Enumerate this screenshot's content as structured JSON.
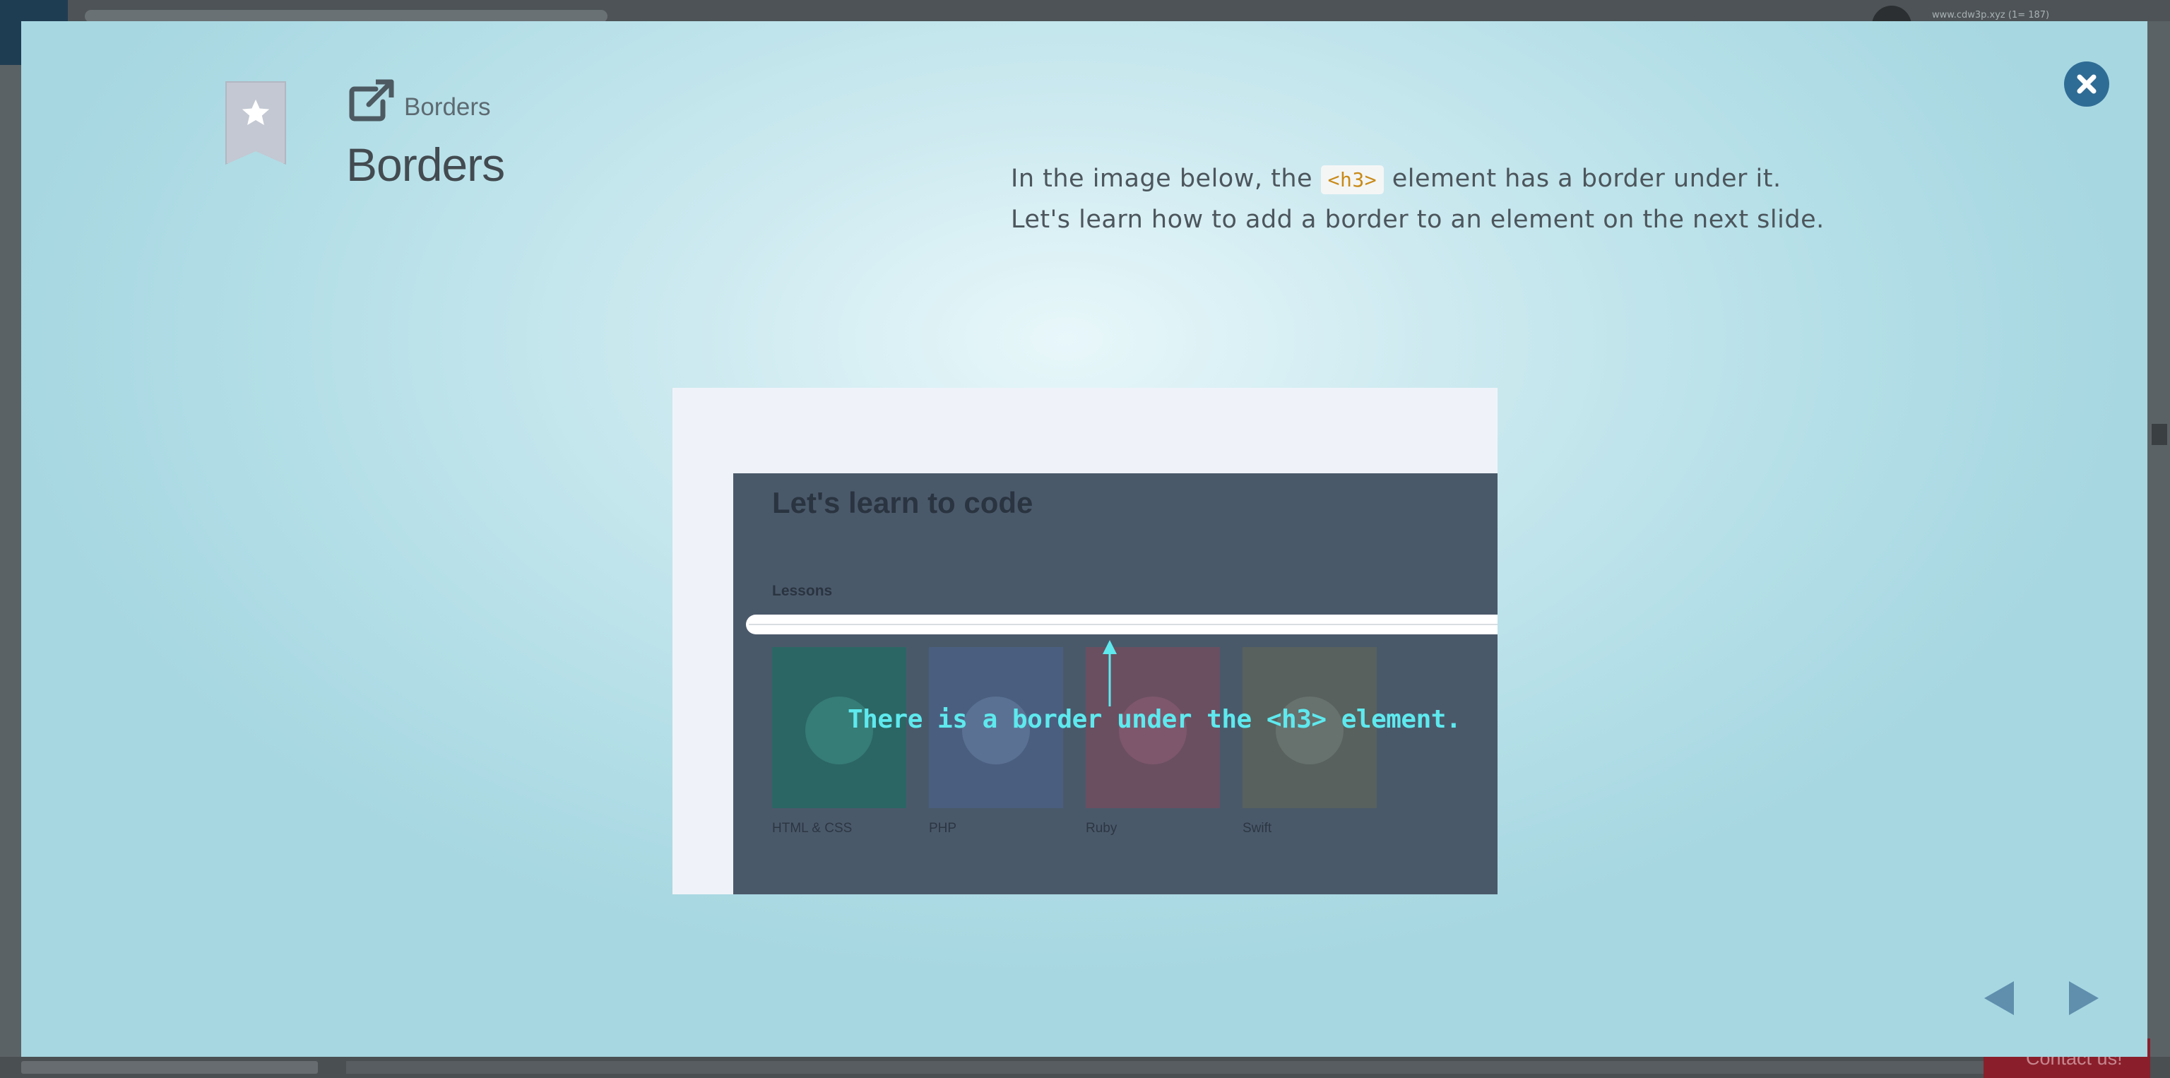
{
  "background": {
    "site_text": "www.cdw3p.xyz (1= 187)",
    "contact_label": "Contact us!"
  },
  "modal": {
    "breadcrumb": "Borders",
    "title": "Borders",
    "description": {
      "line1_before": "In the image below, the ",
      "line1_code": "<h3>",
      "line1_after": " element has a border under it.",
      "line2": "Let's learn how to add a border to an element on the next slide."
    },
    "slide_image": {
      "heading": "Let's learn to code",
      "section_label": "Lessons",
      "cards": [
        {
          "label": "HTML & CSS",
          "color": "#2b6664"
        },
        {
          "label": "PHP",
          "color": "#4a5f80"
        },
        {
          "label": "Ruby",
          "color": "#6a4f60"
        },
        {
          "label": "Swift",
          "color": "#58615d"
        }
      ],
      "annotation": "There is a border under the <h3> element."
    },
    "icons": {
      "bookmark": "star-bookmark-icon",
      "external": "external-link-icon",
      "close": "close-icon",
      "prev": "triangle-left-icon",
      "next": "triangle-right-icon"
    },
    "colors": {
      "accent": "#2f6c95",
      "nav_arrow": "#5f8fad",
      "annotation": "#5ee9ee",
      "code": "#c98a18"
    }
  }
}
